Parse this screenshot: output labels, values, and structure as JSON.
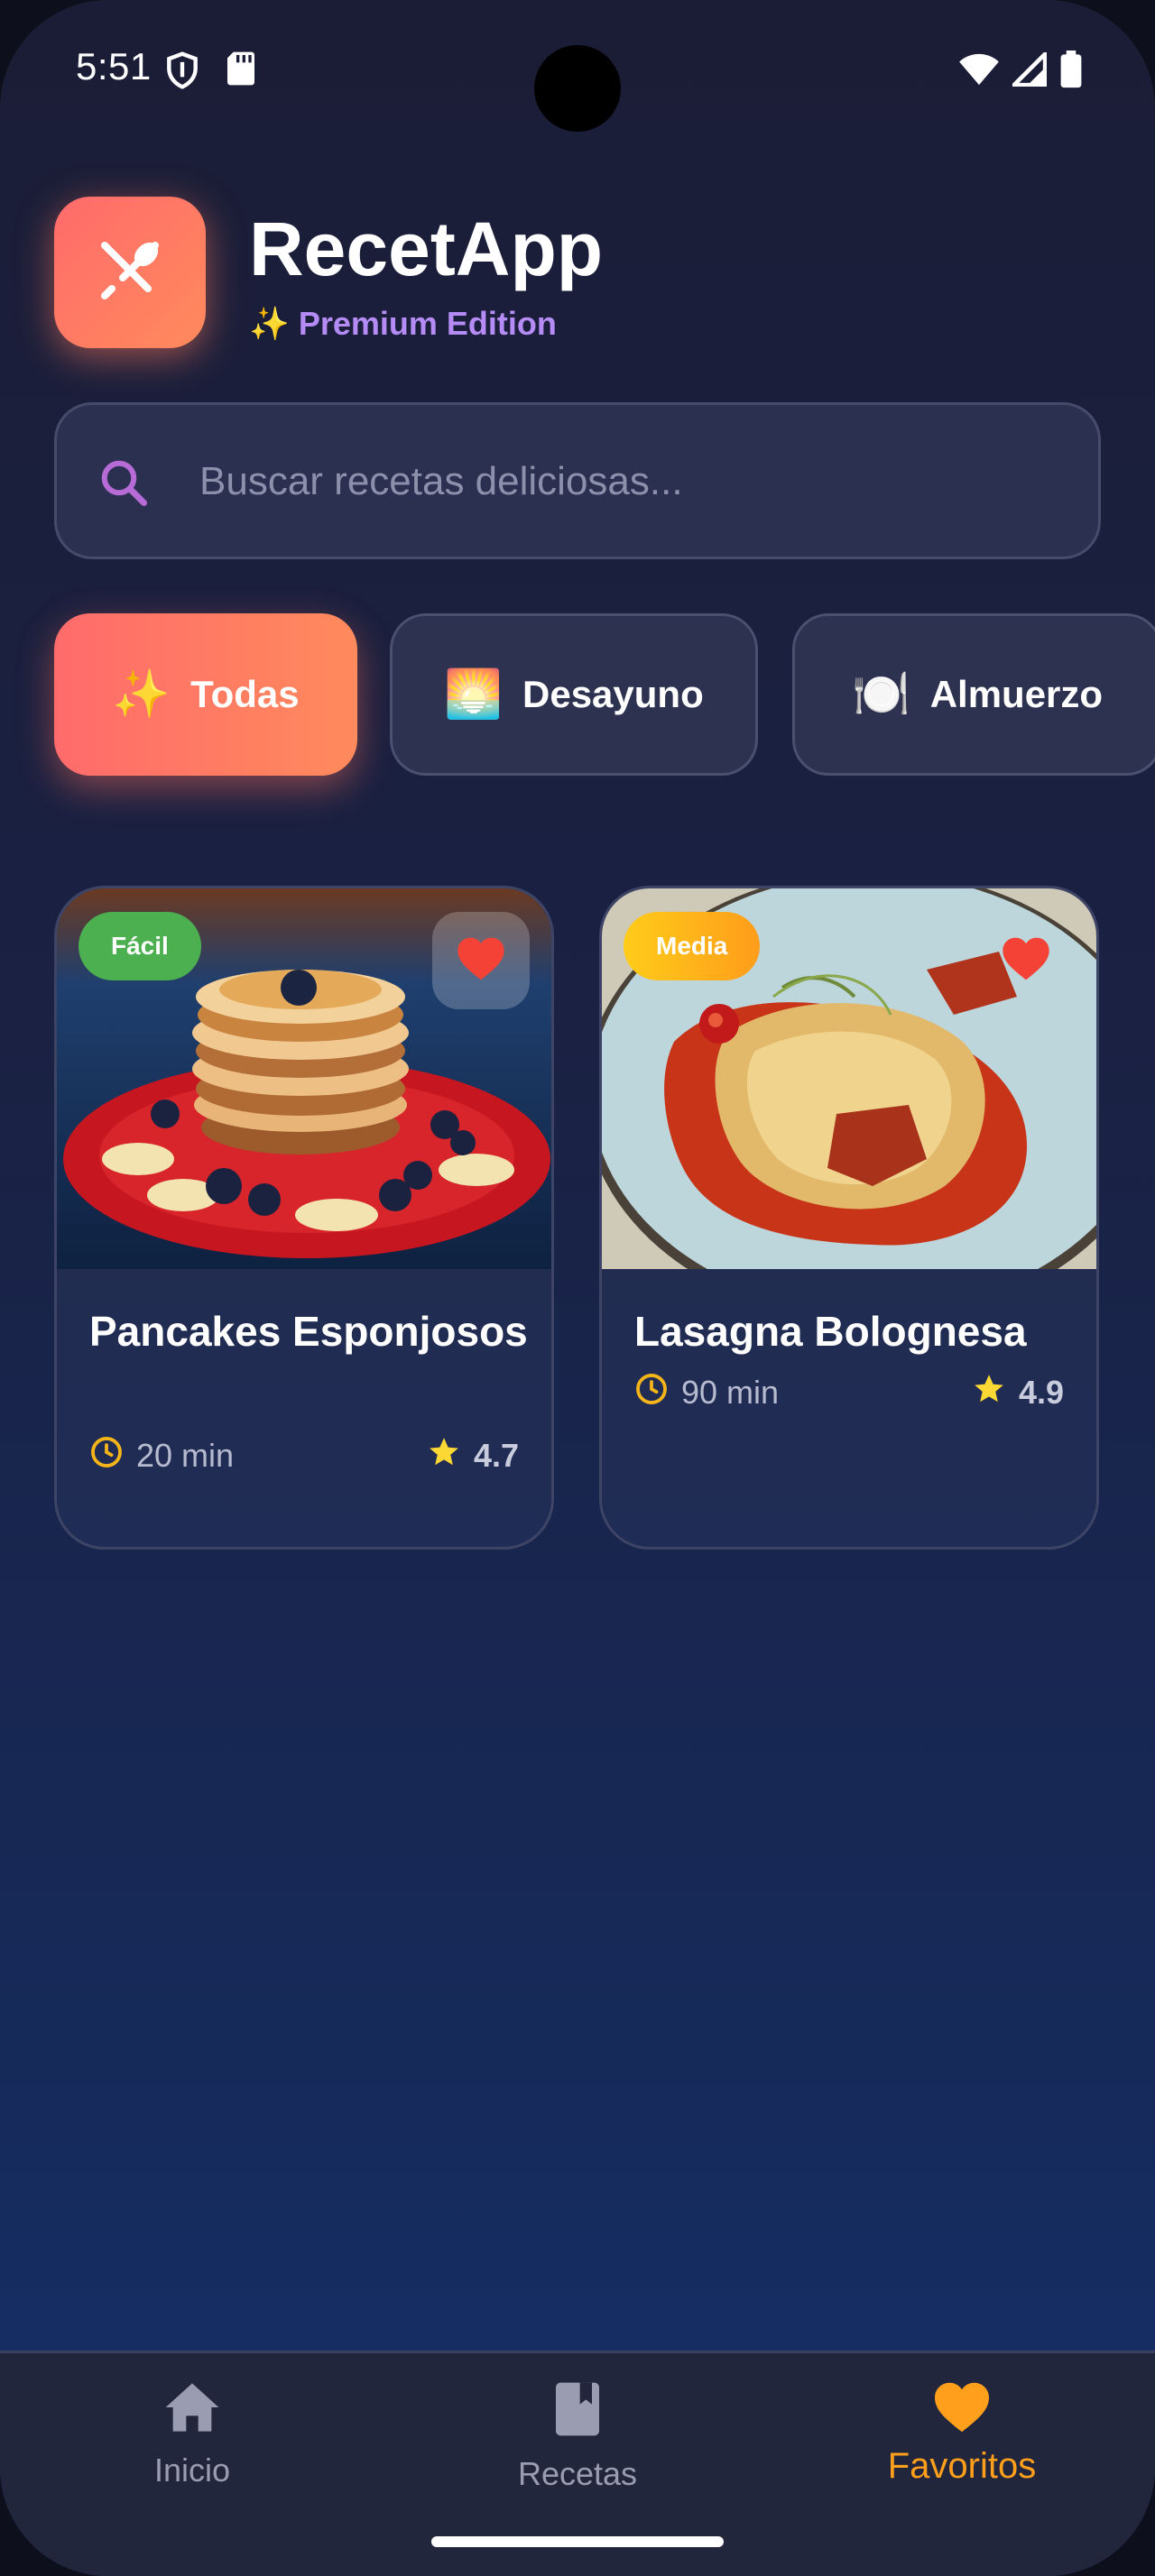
{
  "status_bar": {
    "time": "5:51",
    "left_icons": [
      "shield-icon",
      "sd-card-icon"
    ],
    "right_icons": [
      "wifi-icon",
      "signal-icon",
      "battery-icon"
    ]
  },
  "header": {
    "app_name": "RecetApp",
    "subtitle": "✨ Premium Edition",
    "logo_icon": "utensils-icon",
    "subtitle_color": "#b58cf6"
  },
  "search": {
    "placeholder": "Buscar recetas deliciosas...",
    "value": ""
  },
  "categories": [
    {
      "emoji": "✨",
      "label": "Todas",
      "active": true
    },
    {
      "emoji": "🌅",
      "label": "Desayuno",
      "active": false
    },
    {
      "emoji": "🍽️",
      "label": "Almuerzo",
      "active": false
    }
  ],
  "recipes": [
    {
      "title": "Pancakes Esponjosos",
      "difficulty": "Fácil",
      "time": "20 min",
      "rating": "4.7",
      "favorite": true,
      "image": "pancakes-stack"
    },
    {
      "title": "Lasagna Bolognesa",
      "difficulty": "Media",
      "time": "90 min",
      "rating": "4.9",
      "favorite": true,
      "image": "lasagna-plate"
    }
  ],
  "bottom_nav": [
    {
      "label": "Inicio",
      "icon": "home-icon",
      "active": false
    },
    {
      "label": "Recetas",
      "icon": "book-icon",
      "active": false
    },
    {
      "label": "Favoritos",
      "icon": "heart-icon",
      "active": true
    }
  ],
  "colors": {
    "accent_gradient_start": "#ff6b6b",
    "accent_gradient_end": "#ff8a5c",
    "favorite_heart": "#f44336",
    "active_nav": "#ff9f1c",
    "badge_easy": "#4caf50",
    "badge_medium": "#ffb31a",
    "star": "#fdd835"
  }
}
